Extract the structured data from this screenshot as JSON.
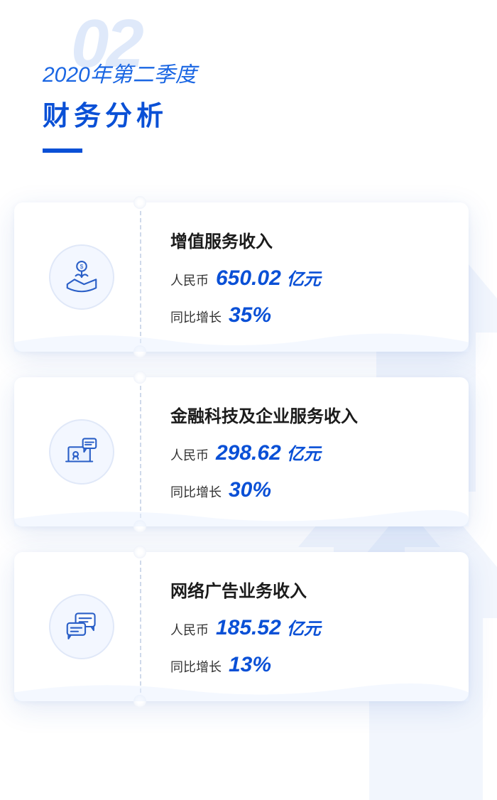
{
  "header": {
    "section_number": "02",
    "subtitle": "2020年第二季度",
    "title": "财务分析"
  },
  "labels": {
    "currency": "人民币",
    "unit": "亿元",
    "yoy": "同比增长"
  },
  "cards": [
    {
      "icon": "money-plant-icon",
      "title": "增值服务收入",
      "amount": "650.02",
      "growth": "35%"
    },
    {
      "icon": "laptop-chat-icon",
      "title": "金融科技及企业服务收入",
      "amount": "298.62",
      "growth": "30%"
    },
    {
      "icon": "chat-bubbles-icon",
      "title": "网络广告业务收入",
      "amount": "185.52",
      "growth": "13%"
    }
  ]
}
